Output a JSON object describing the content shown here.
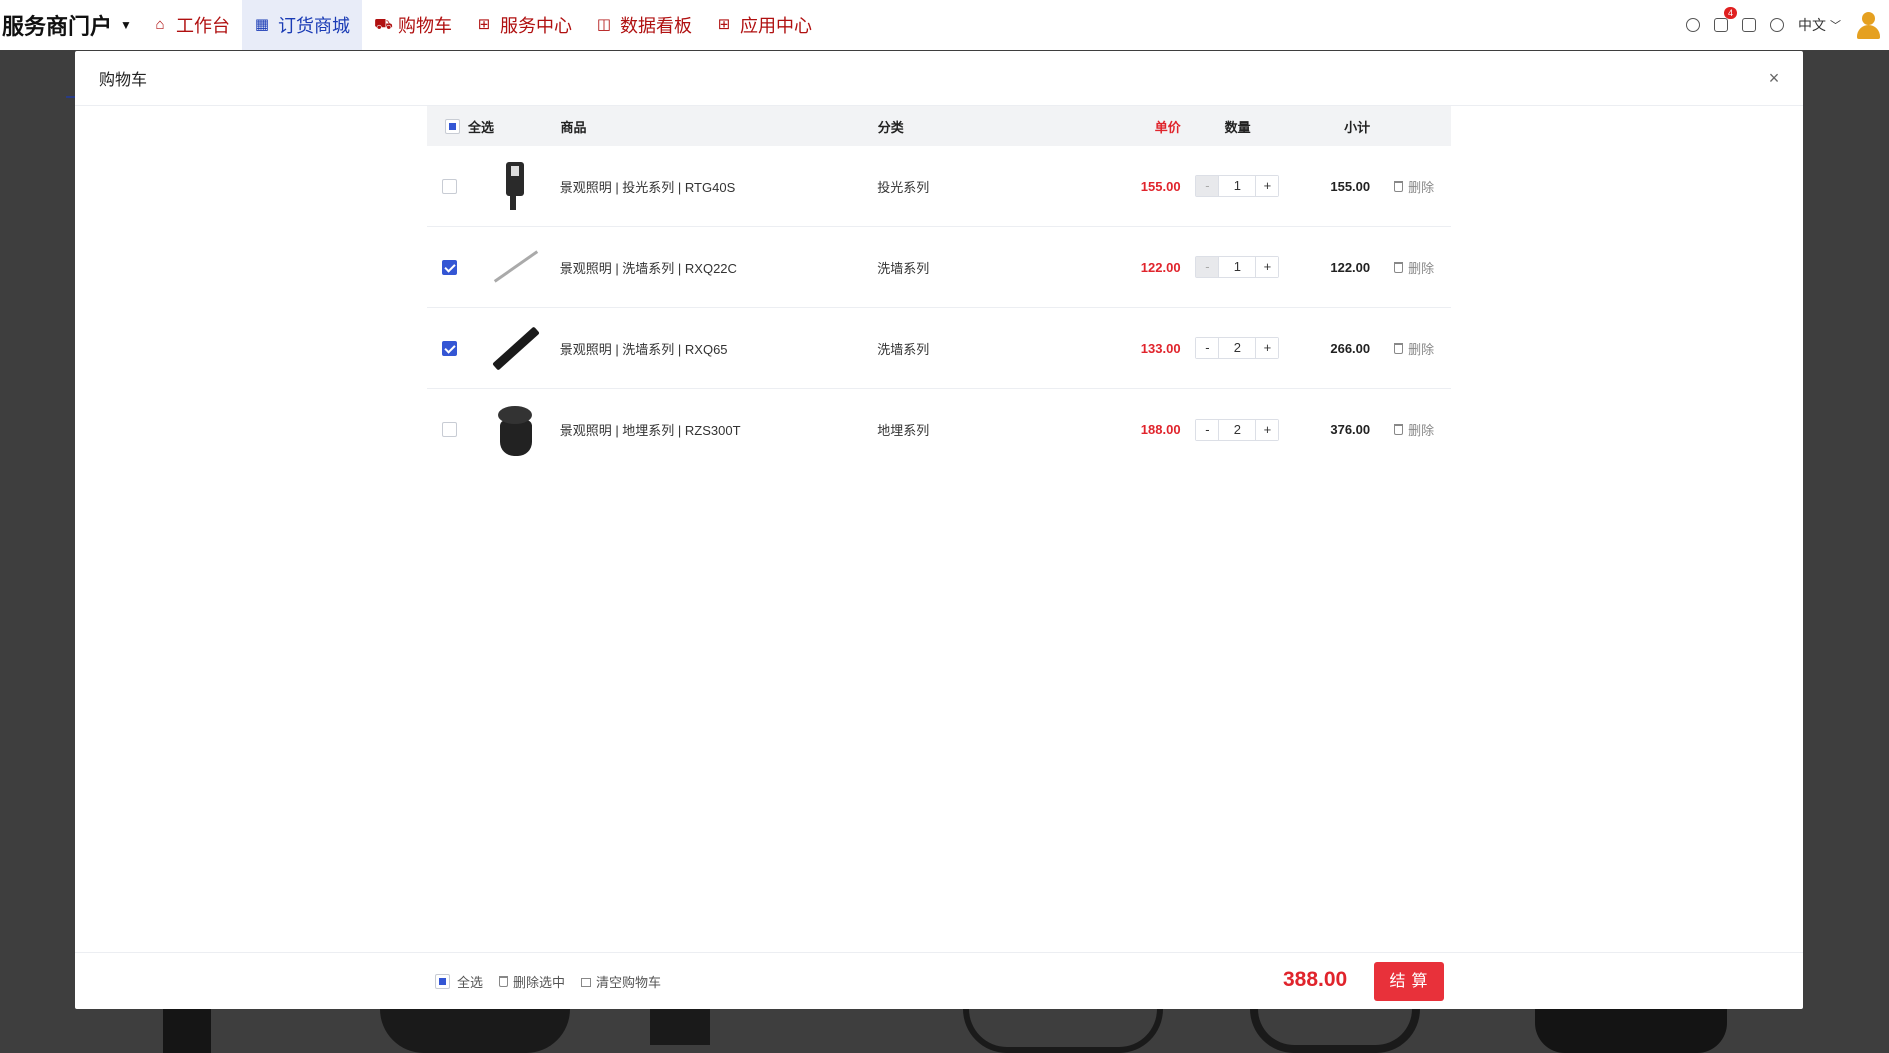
{
  "topnav": {
    "brand": "服务商门户",
    "items": [
      {
        "label": "工作台",
        "icon": "home-icon",
        "active": false
      },
      {
        "label": "订货商城",
        "icon": "store-icon",
        "active": true
      },
      {
        "label": "购物车",
        "icon": "cart-icon",
        "active": false
      },
      {
        "label": "服务中心",
        "icon": "grid-icon",
        "active": false
      },
      {
        "label": "数据看板",
        "icon": "chart-icon",
        "active": false
      },
      {
        "label": "应用中心",
        "icon": "grid-icon",
        "active": false
      }
    ],
    "cart_badge": "4",
    "language": "中文"
  },
  "dialog": {
    "title": "购物车",
    "close_label": "×",
    "header": {
      "select_all": "全选",
      "product": "商品",
      "category": "分类",
      "unit_price": "单价",
      "quantity": "数量",
      "subtotal": "小计"
    },
    "rows": [
      {
        "checked": false,
        "image": "floodlight-product",
        "name": "景观照明 | 投光系列 | RTG40S",
        "category": "投光系列",
        "price": "155.00",
        "qty": "1",
        "minus_disabled": true,
        "subtotal": "155.00",
        "delete": "删除"
      },
      {
        "checked": true,
        "image": "linear-wallwasher-product",
        "name": "景观照明 | 洗墙系列 | RXQ22C",
        "category": "洗墙系列",
        "price": "122.00",
        "qty": "1",
        "minus_disabled": true,
        "subtotal": "122.00",
        "delete": "删除"
      },
      {
        "checked": true,
        "image": "linear-wallwasher-black-product",
        "name": "景观照明 | 洗墙系列 | RXQ65",
        "category": "洗墙系列",
        "price": "133.00",
        "qty": "2",
        "minus_disabled": false,
        "subtotal": "266.00",
        "delete": "删除"
      },
      {
        "checked": false,
        "image": "inground-light-product",
        "name": "景观照明 | 地埋系列 | RZS300T",
        "category": "地埋系列",
        "price": "188.00",
        "qty": "2",
        "minus_disabled": false,
        "subtotal": "376.00",
        "delete": "删除"
      }
    ],
    "stepper_minus": "-",
    "stepper_plus": "+",
    "footer": {
      "select_all": "全选",
      "delete_selected": "删除选中",
      "clear_cart": "清空购物车",
      "total": "388.00",
      "checkout": "结算"
    }
  },
  "colors": {
    "accent": "#3456d4",
    "price": "#e0242c",
    "checkout": "#e8313a"
  }
}
